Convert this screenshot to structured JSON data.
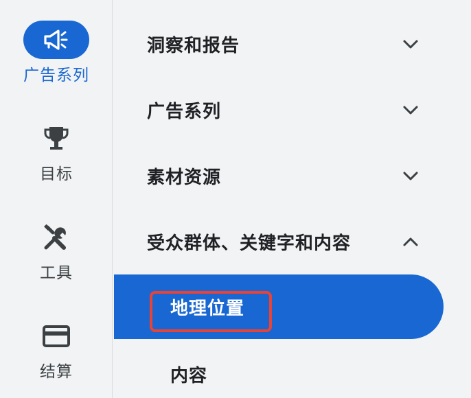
{
  "rail": {
    "items": [
      {
        "label": "广告系列",
        "icon": "megaphone-icon",
        "active": true
      },
      {
        "label": "目标",
        "icon": "trophy-icon",
        "active": false
      },
      {
        "label": "工具",
        "icon": "tools-icon",
        "active": false
      },
      {
        "label": "结算",
        "icon": "credit-card-icon",
        "active": false
      }
    ]
  },
  "nav": {
    "sections": [
      {
        "label": "洞察和报告",
        "expanded": false,
        "chevron": "chevron-down-icon"
      },
      {
        "label": "广告系列",
        "expanded": false,
        "chevron": "chevron-down-icon"
      },
      {
        "label": "素材资源",
        "expanded": false,
        "chevron": "chevron-down-icon"
      },
      {
        "label": "受众群体、关键字和内容",
        "expanded": true,
        "chevron": "chevron-up-icon"
      }
    ],
    "sub_items": [
      {
        "label": "地理位置",
        "selected": true
      },
      {
        "label": "内容",
        "selected": false
      }
    ]
  },
  "colors": {
    "accent": "#1967d2",
    "highlight_border": "#ea4335",
    "background": "#f1f3f4",
    "text": "#202124"
  }
}
